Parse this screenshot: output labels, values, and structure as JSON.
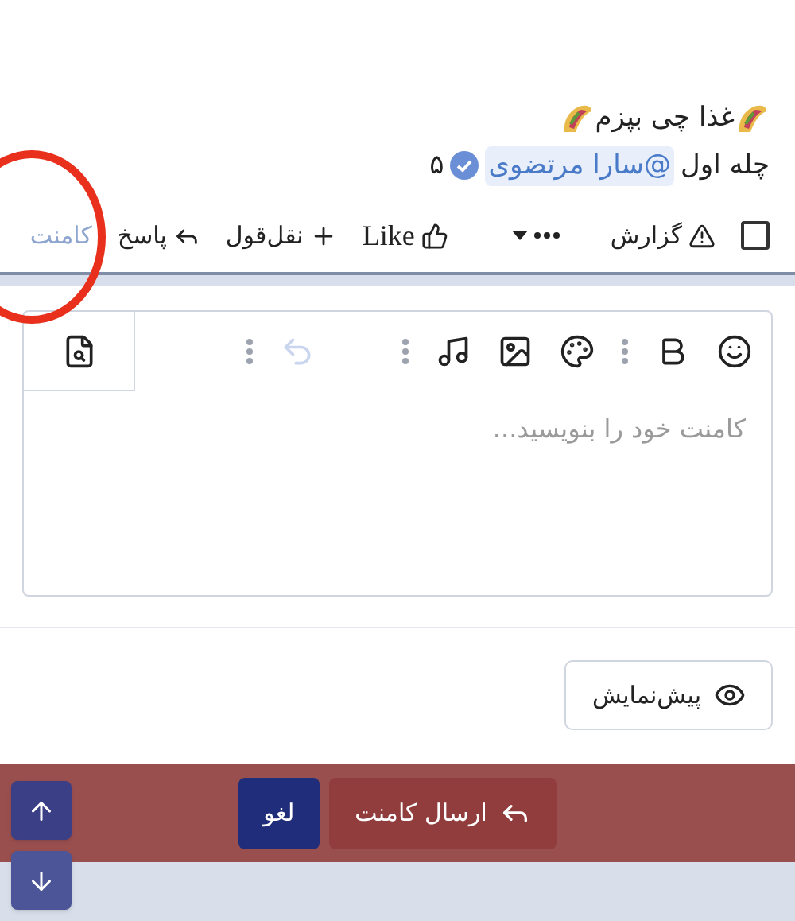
{
  "post": {
    "title": "غذا چی بپزم",
    "line_text": "چله اول",
    "mention": "@سارا مرتضوی",
    "verified": true,
    "count": "۵"
  },
  "select_checkbox": {
    "checked": false
  },
  "actions": [
    {
      "kind": "report",
      "label": "گزارش",
      "disabled": false
    },
    {
      "kind": "more",
      "disabled": false
    },
    {
      "kind": "like",
      "label": "Like",
      "disabled": false
    },
    {
      "kind": "quote",
      "label": "نقل‌قول",
      "disabled": false
    },
    {
      "kind": "reply",
      "label": "پاسخ",
      "disabled": false
    },
    {
      "kind": "comment",
      "label": "کامنت",
      "disabled": true
    }
  ],
  "editor": {
    "undo_disabled": true,
    "placeholder": "کامنت خود را بنویسید..."
  },
  "preview_button": "پیش‌نمایش",
  "footer": {
    "submit": "ارسال کامنت",
    "cancel": "لغو"
  }
}
